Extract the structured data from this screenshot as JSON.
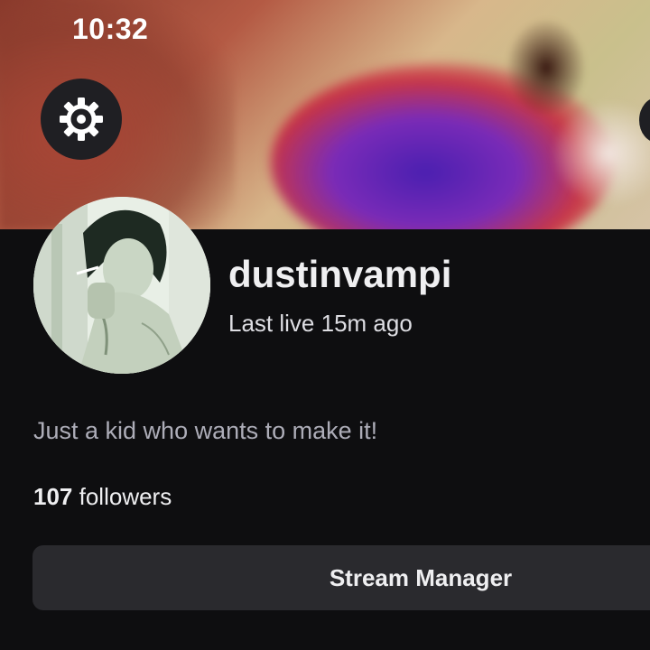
{
  "status_bar": {
    "time": "10:32"
  },
  "header": {
    "settings_icon": "gear-icon"
  },
  "profile": {
    "username": "dustinvampi",
    "last_live": "Last live 15m ago",
    "bio": "Just a kid who wants to make it!",
    "followers_count": "107",
    "followers_label": "followers"
  },
  "actions": {
    "stream_manager_label": "Stream Manager"
  },
  "colors": {
    "background": "#0e0e10",
    "button_bg": "#2a2a2e",
    "text_primary": "#efeff1",
    "text_secondary": "#adadb8"
  }
}
